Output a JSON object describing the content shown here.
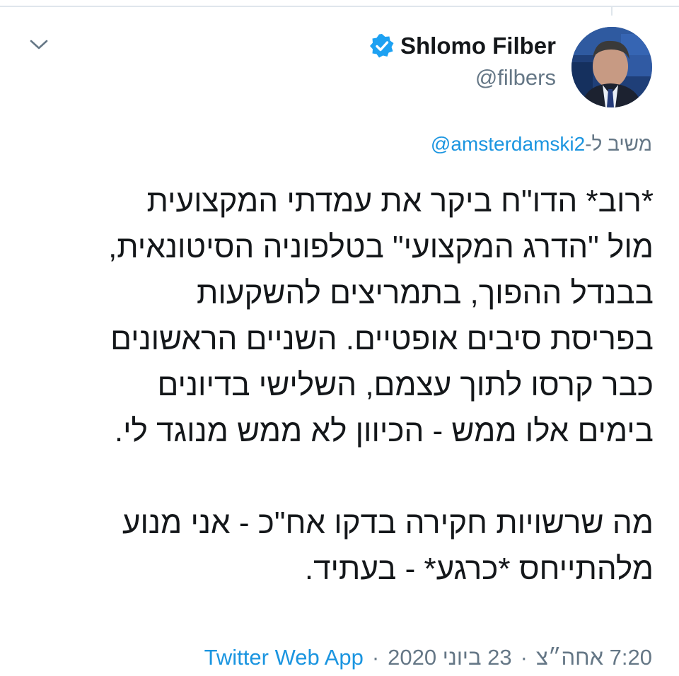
{
  "tweet": {
    "author": {
      "display_name": "Shlomo Filber",
      "handle": "@filbers",
      "verified": true
    },
    "reply": {
      "prefix": "משיב ל-",
      "to_handle": "@amsterdamski2"
    },
    "text_lines": [
      "*רוב* הדו\"ח ביקר את עמדתי המקצועית",
      "מול \"הדרג המקצועי\" בטלפוניה הסיטונאית,",
      "בבנדל ההפוך, בתמריצים להשקעות",
      "בפריסת סיבים אופטיים. השניים הראשונים",
      "כבר קרסו לתוך עצמם, השלישי בדיונים",
      "בימים אלו ממש - הכיוון לא ממש מנוגד לי.",
      "",
      "מה שרשויות חקירה בדקו אח\"כ - אני מנוע",
      "מלהתייחס *כרגע* - בעתיד."
    ],
    "footer": {
      "time": "7:20 אחה״צ",
      "date": "23 ביוני 2020",
      "separator": "·",
      "source": "Twitter Web App"
    }
  },
  "icons": {
    "chevron": "chevron-down-icon",
    "verified": "verified-badge-icon",
    "avatar": "avatar"
  },
  "colors": {
    "link": "#1b95e0",
    "muted": "#657786",
    "text": "#14171a",
    "verified": "#1da1f2"
  }
}
